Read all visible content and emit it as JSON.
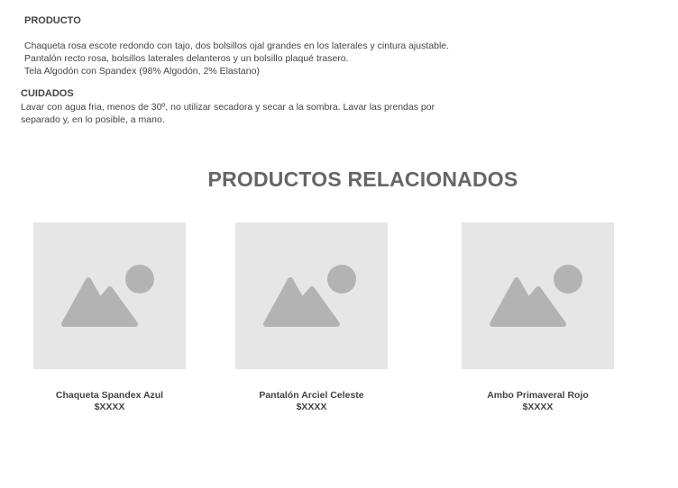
{
  "product_section": {
    "label": "PRODUCTO",
    "description_lines": [
      "Chaqueta rosa escote redondo con tajo, dos bolsillos ojal grandes en los laterales y cintura ajustable.",
      "Pantalón recto rosa, bolsillos laterales delanteros y un bolsillo plaqué trasero.",
      "Tela Algodón con Spandex (98% Algodón, 2% Elastano)"
    ]
  },
  "care_section": {
    "label": "CUIDADOS",
    "text": "Lavar con agua fria, menos de 30º, no utilizar secadora y secar a la sombra. Lavar las prendas por separado y, en lo posible, a mano."
  },
  "related": {
    "title": "PRODUCTOS RELACIONADOS",
    "products": [
      {
        "name": "Chaqueta Spandex Azul",
        "price": "$XXXX",
        "image_icon": "image-placeholder-icon"
      },
      {
        "name": "Pantalón Arciel Celeste",
        "price": "$XXXX",
        "image_icon": "image-placeholder-icon"
      },
      {
        "name": "Ambo Primaveral Rojo",
        "price": "$XXXX",
        "image_icon": "image-placeholder-icon"
      }
    ]
  },
  "colors": {
    "placeholder_bg": "#e6e6e6",
    "placeholder_shape": "#b3b3b3",
    "text": "#444444",
    "heading": "#666666"
  }
}
